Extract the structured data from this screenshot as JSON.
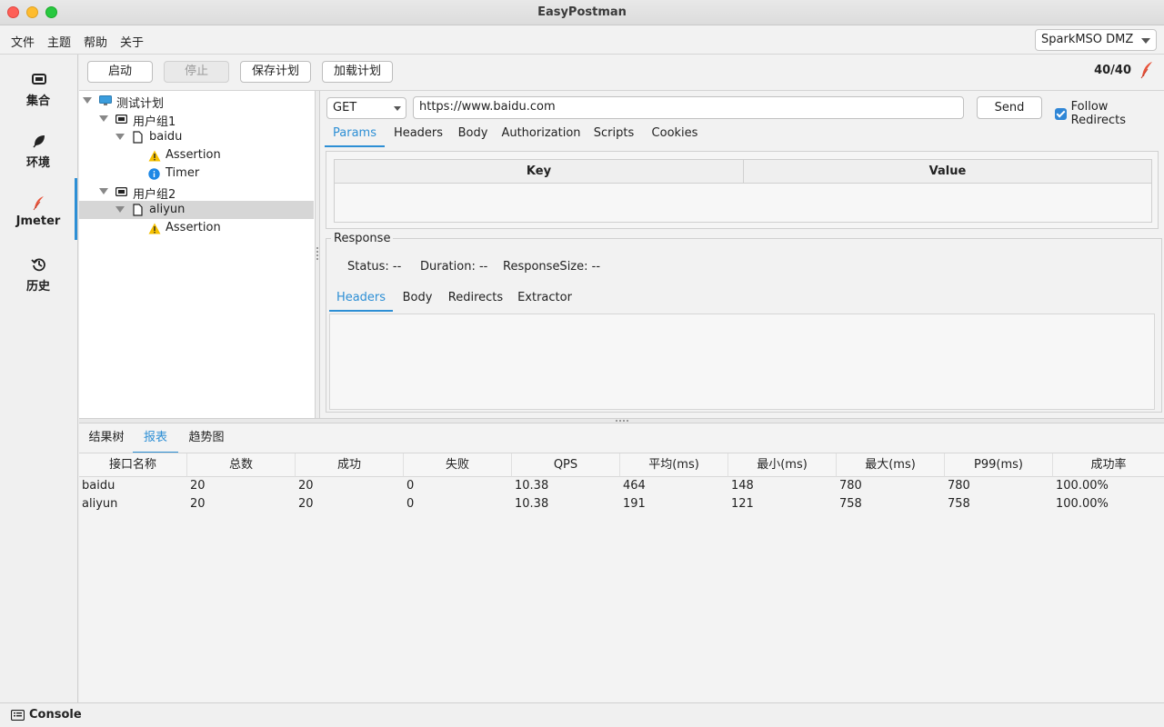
{
  "window": {
    "title": "EasyPostman"
  },
  "menu": {
    "items": [
      "文件",
      "主题",
      "帮助",
      "关于"
    ],
    "environment": "SparkMSO DMZ"
  },
  "nav": {
    "items": [
      {
        "label": "集合",
        "icon": "collection-icon"
      },
      {
        "label": "环境",
        "icon": "leaf-icon"
      },
      {
        "label": "Jmeter",
        "icon": "feather-icon"
      },
      {
        "label": "历史",
        "icon": "history-icon"
      }
    ],
    "active": "Jmeter"
  },
  "toolbar": {
    "start": "启动",
    "stop": "停止",
    "save_plan": "保存计划",
    "load_plan": "加载计划",
    "counter": "40/40"
  },
  "tree": {
    "nodes": [
      {
        "label": "测试计划",
        "type": "plan"
      },
      {
        "label": "用户组1",
        "type": "group"
      },
      {
        "label": "baidu",
        "type": "request"
      },
      {
        "label": "Assertion",
        "type": "assertion"
      },
      {
        "label": "Timer",
        "type": "timer"
      },
      {
        "label": "用户组2",
        "type": "group"
      },
      {
        "label": "aliyun",
        "type": "request",
        "selected": true
      },
      {
        "label": "Assertion",
        "type": "assertion"
      }
    ]
  },
  "request": {
    "method": "GET",
    "url": "https://www.baidu.com",
    "send": "Send",
    "follow_redirects": "Follow Redirects",
    "tabs": [
      "Params",
      "Headers",
      "Body",
      "Authorization",
      "Scripts",
      "Cookies"
    ],
    "active_tab": "Params",
    "params_columns": [
      "Key",
      "Value"
    ]
  },
  "response": {
    "title": "Response",
    "status": "Status: --",
    "duration": "Duration: --",
    "size": "ResponseSize: --",
    "tabs": [
      "Headers",
      "Body",
      "Redirects",
      "Extractor"
    ],
    "active_tab": "Headers"
  },
  "results": {
    "tabs": [
      "结果树",
      "报表",
      "趋势图"
    ],
    "active_tab": "报表",
    "columns": [
      "接口名称",
      "总数",
      "成功",
      "失败",
      "QPS",
      "平均(ms)",
      "最小(ms)",
      "最大(ms)",
      "P99(ms)",
      "成功率"
    ],
    "rows": [
      [
        "baidu",
        "20",
        "20",
        "0",
        "10.38",
        "464",
        "148",
        "780",
        "780",
        "100.00%"
      ],
      [
        "aliyun",
        "20",
        "20",
        "0",
        "10.38",
        "191",
        "121",
        "758",
        "758",
        "100.00%"
      ]
    ]
  },
  "status": {
    "console": "Console"
  },
  "colors": {
    "accent": "#2d8fd5",
    "warning": "#f5c000",
    "info": "#1e88e5"
  }
}
